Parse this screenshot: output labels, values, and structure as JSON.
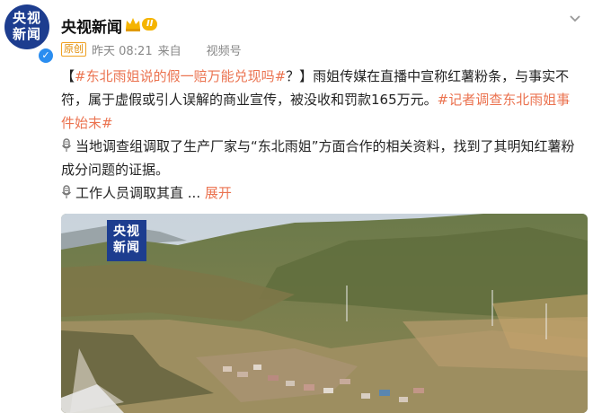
{
  "account": {
    "avatar_text": "央视\n新闻",
    "name": "央视新闻",
    "level": "II"
  },
  "meta": {
    "original_tag": "原创",
    "time": "昨天 08:21",
    "from": "来自",
    "source": "视频号"
  },
  "post": {
    "open_bracket": "【",
    "topic1": "#东北雨姐说的假一赔万能兑现吗#",
    "after_topic1": "？】雨姐传媒在直播中宣称红薯粉条，与事实不符，属于虚假或引人误解的商业宣传，被没收和罚款165万元。",
    "topic2": "#记者调查东北雨姐事件始末#",
    "para2": "当地调查组调取了生产厂家与“东北雨姐”方面合作的相关资料，找到了其明知红薯粉成分问题的证据。",
    "para3": "工作人员调取其直",
    "ellipsis": " ... ",
    "expand": "展开"
  },
  "video": {
    "watermark": "央视\n新闻"
  }
}
